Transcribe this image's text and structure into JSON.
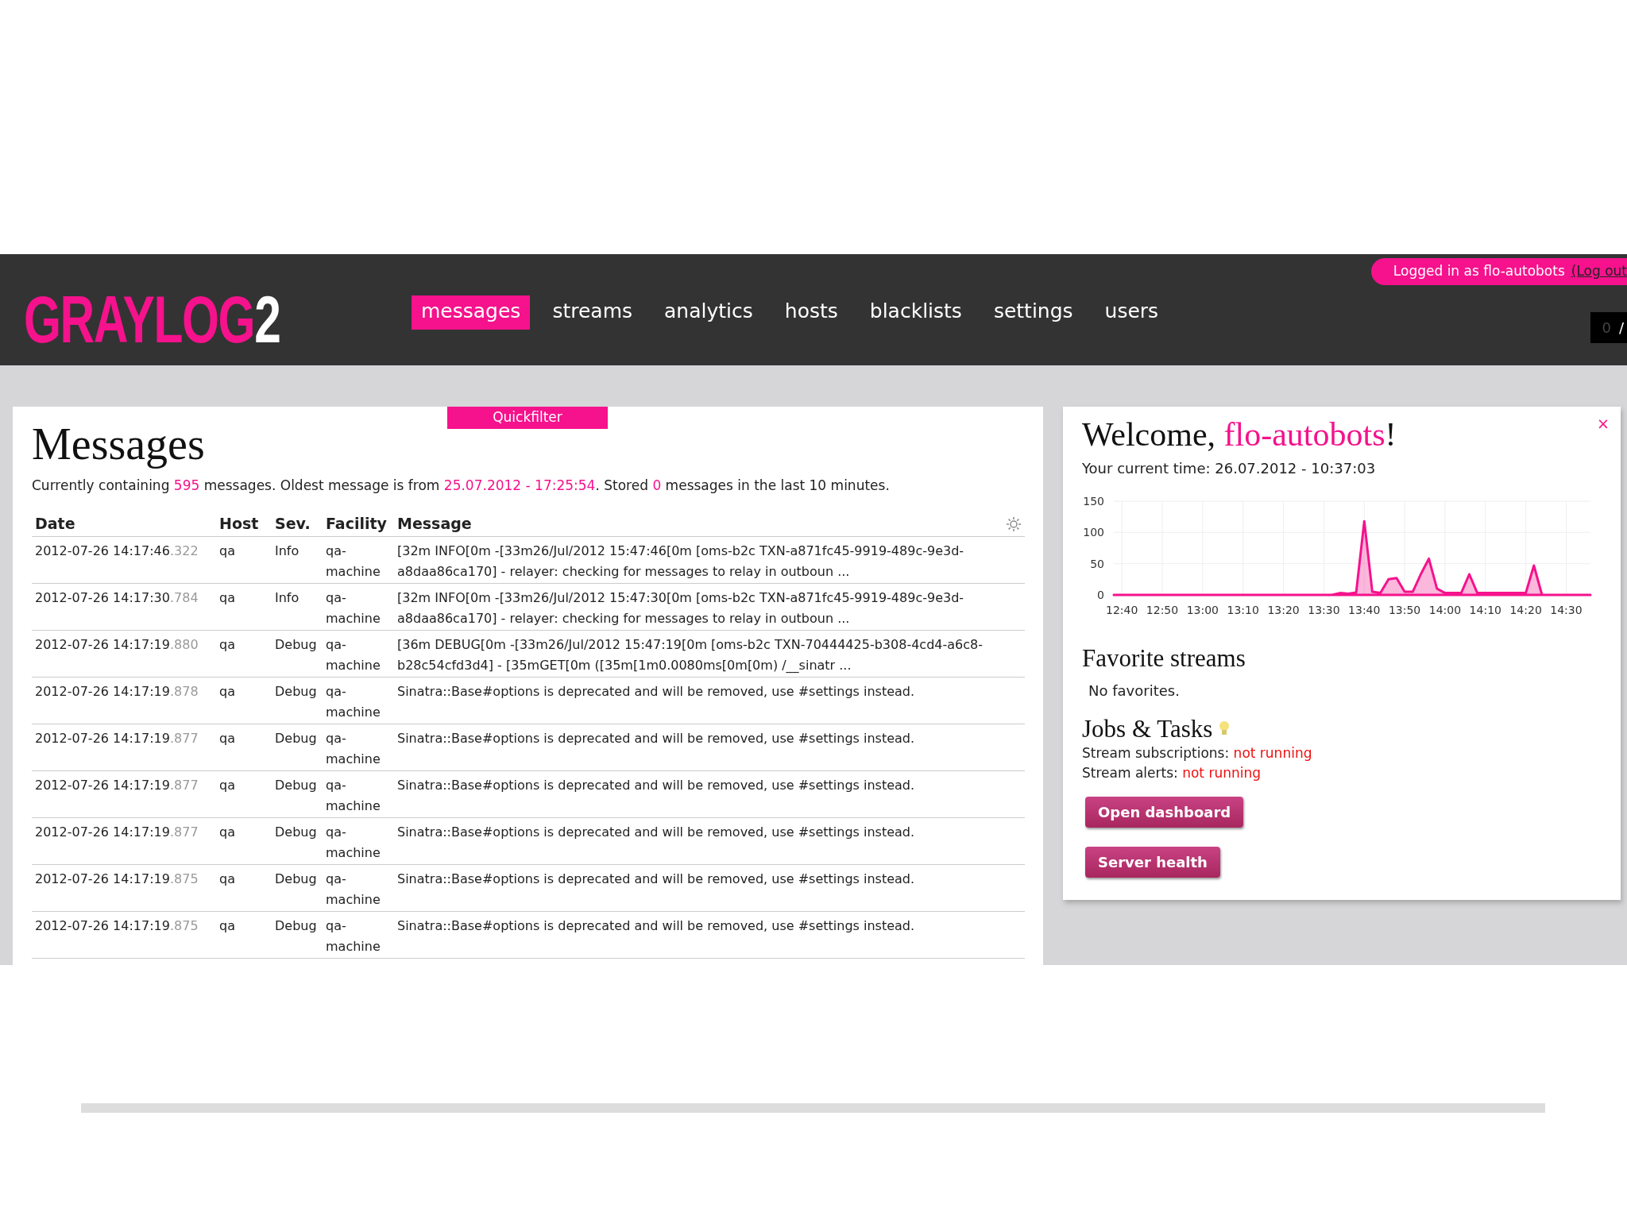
{
  "header": {
    "logo_text": "GRAYLOG",
    "logo_version": "2",
    "nav": [
      {
        "label": "messages",
        "selected": true
      },
      {
        "label": "streams",
        "selected": false
      },
      {
        "label": "analytics",
        "selected": false
      },
      {
        "label": "hosts",
        "selected": false
      },
      {
        "label": "blacklists",
        "selected": false
      },
      {
        "label": "settings",
        "selected": false
      },
      {
        "label": "users",
        "selected": false
      }
    ],
    "login": {
      "text": "Logged in as flo-autobots",
      "logout": "(Log out"
    },
    "counter": {
      "value": "0",
      "separator": "/"
    }
  },
  "messages": {
    "quickfilter": "Quickfilter",
    "title": "Messages",
    "summary": [
      {
        "text": "Currently containing ",
        "highlight": false
      },
      {
        "text": "595",
        "highlight": true
      },
      {
        "text": " messages. Oldest message is from ",
        "highlight": false
      },
      {
        "text": "25.07.2012 - 17:25:54",
        "highlight": true
      },
      {
        "text": ". Stored ",
        "highlight": false
      },
      {
        "text": "0",
        "highlight": true
      },
      {
        "text": " messages in the last 10 minutes.",
        "highlight": false
      }
    ],
    "columns": [
      "Date",
      "Host",
      "Sev.",
      "Facility",
      "Message"
    ],
    "rows": [
      {
        "date": "2012-07-26 14:17:46",
        "ms": ".322",
        "host": "qa",
        "severity": "Info",
        "facility": "qa-machine",
        "message": "[32m INFO[0m -[33m26/Jul/2012 15:47:46[0m [oms-b2c TXN-a871fc45-9919-489c-9e3d-a8daa86ca170] - relayer: checking for messages to relay in outboun ..."
      },
      {
        "date": "2012-07-26 14:17:30",
        "ms": ".784",
        "host": "qa",
        "severity": "Info",
        "facility": "qa-machine",
        "message": "[32m INFO[0m -[33m26/Jul/2012 15:47:30[0m [oms-b2c TXN-a871fc45-9919-489c-9e3d-a8daa86ca170] - relayer: checking for messages to relay in outboun ..."
      },
      {
        "date": "2012-07-26 14:17:19",
        "ms": ".880",
        "host": "qa",
        "severity": "Debug",
        "facility": "qa-machine",
        "message": "[36m DEBUG[0m -[33m26/Jul/2012 15:47:19[0m [oms-b2c TXN-70444425-b308-4cd4-a6c8-b28c54cfd3d4] - [35mGET[0m ([35m[1m0.0080ms[0m[0m) /__sinatr ..."
      },
      {
        "date": "2012-07-26 14:17:19",
        "ms": ".878",
        "host": "qa",
        "severity": "Debug",
        "facility": "qa-machine",
        "message": "Sinatra::Base#options is deprecated and will be removed, use #settings instead."
      },
      {
        "date": "2012-07-26 14:17:19",
        "ms": ".877",
        "host": "qa",
        "severity": "Debug",
        "facility": "qa-machine",
        "message": "Sinatra::Base#options is deprecated and will be removed, use #settings instead."
      },
      {
        "date": "2012-07-26 14:17:19",
        "ms": ".877",
        "host": "qa",
        "severity": "Debug",
        "facility": "qa-machine",
        "message": "Sinatra::Base#options is deprecated and will be removed, use #settings instead."
      },
      {
        "date": "2012-07-26 14:17:19",
        "ms": ".877",
        "host": "qa",
        "severity": "Debug",
        "facility": "qa-machine",
        "message": "Sinatra::Base#options is deprecated and will be removed, use #settings instead."
      },
      {
        "date": "2012-07-26 14:17:19",
        "ms": ".875",
        "host": "qa",
        "severity": "Debug",
        "facility": "qa-machine",
        "message": "Sinatra::Base#options is deprecated and will be removed, use #settings instead."
      },
      {
        "date": "2012-07-26 14:17:19",
        "ms": ".875",
        "host": "qa",
        "severity": "Debug",
        "facility": "qa-machine",
        "message": "Sinatra::Base#options is deprecated and will be removed, use #settings instead."
      }
    ]
  },
  "welcome": {
    "close": "×",
    "greeting": "Welcome, ",
    "user": "flo-autobots",
    "exclaim": "!",
    "current_time": "Your current time: 26.07.2012 - 10:37:03",
    "chart_data": {
      "type": "area",
      "categories": [
        null,
        "12:40",
        null,
        null,
        null,
        null,
        "12:50",
        null,
        null,
        null,
        null,
        "13:00",
        null,
        null,
        null,
        null,
        "13:10",
        null,
        null,
        null,
        null,
        "13:20",
        null,
        null,
        null,
        null,
        "13:30",
        null,
        null,
        null,
        null,
        "13:40",
        null,
        null,
        null,
        null,
        "13:50",
        null,
        null,
        null,
        null,
        "14:00",
        null,
        null,
        null,
        null,
        "14:10",
        null,
        null,
        null,
        null,
        "14:20",
        null,
        null,
        null,
        null,
        "14:30",
        null,
        null,
        null
      ],
      "series": [
        {
          "color": "#f5128c",
          "values": [
            0,
            0,
            0,
            0,
            0,
            0,
            0,
            0,
            0,
            0,
            0,
            0,
            0,
            0,
            0,
            0,
            0,
            0,
            0,
            0,
            0,
            0,
            0,
            0,
            0,
            0,
            0,
            0,
            3,
            2,
            4,
            118,
            5,
            3,
            25,
            27,
            5,
            5,
            33,
            58,
            10,
            3,
            3,
            3,
            33,
            3,
            3,
            3,
            3,
            3,
            3,
            3,
            47,
            0,
            0,
            0,
            0,
            0,
            0,
            0
          ]
        }
      ],
      "ylim": [
        0,
        150
      ],
      "grid": true,
      "yticks": [
        0,
        50,
        100,
        150
      ]
    },
    "favorites_title": "Favorite streams",
    "favorites_empty": "No favorites.",
    "jobs_title": "Jobs & Tasks",
    "jobs": [
      {
        "label": "Stream subscriptions:",
        "status": "not running",
        "running": false
      },
      {
        "label": "Stream alerts:",
        "status": "not running",
        "running": false
      }
    ],
    "buttons": [
      "Open dashboard",
      "Server health"
    ]
  }
}
